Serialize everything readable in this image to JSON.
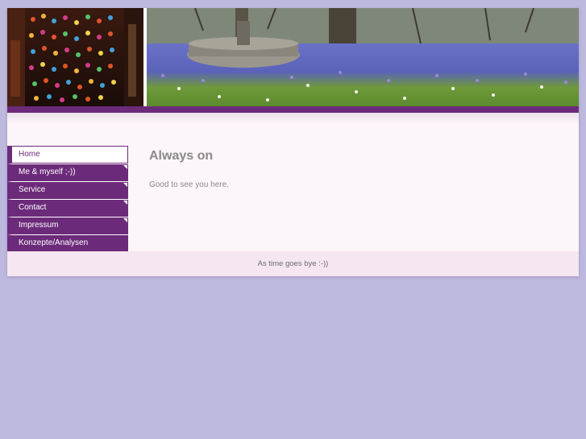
{
  "nav": {
    "items": [
      {
        "label": "Home",
        "active": true
      },
      {
        "label": "Me & myself ;-))",
        "active": false
      },
      {
        "label": "Service",
        "active": false
      },
      {
        "label": "Contact",
        "active": false
      },
      {
        "label": "Impressum",
        "active": false
      },
      {
        "label": "Konzepte/Analysen",
        "active": false
      }
    ]
  },
  "main": {
    "title": "Always on",
    "text": "Good to see you here."
  },
  "footer": {
    "text": "As time goes bye :-))"
  },
  "colors": {
    "page_background": "#bdb8dd",
    "accent": "#6c2b7a",
    "content_background": "#fcf5f9",
    "footer_background": "#f6e6f1"
  }
}
